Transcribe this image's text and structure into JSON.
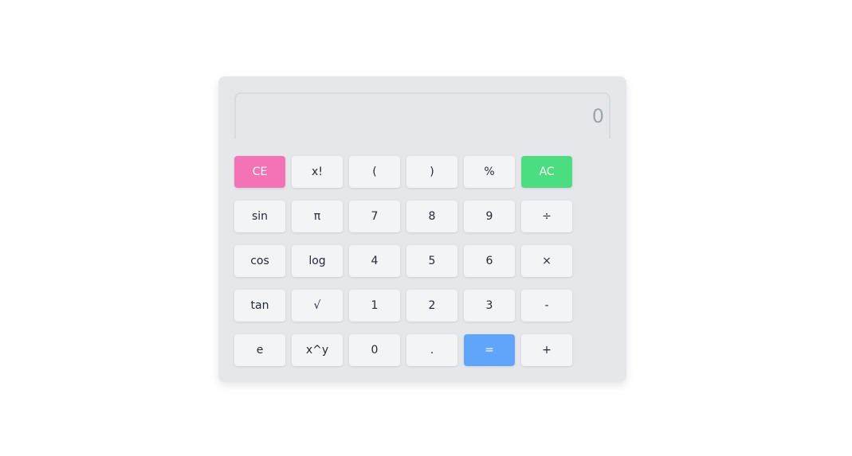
{
  "display": {
    "value": "0"
  },
  "keys": [
    {
      "label": "CE",
      "name": "clear-entry-button",
      "style": "pink"
    },
    {
      "label": "x!",
      "name": "factorial-button",
      "style": ""
    },
    {
      "label": "(",
      "name": "open-paren-button",
      "style": ""
    },
    {
      "label": ")",
      "name": "close-paren-button",
      "style": ""
    },
    {
      "label": "%",
      "name": "percent-button",
      "style": ""
    },
    {
      "label": "AC",
      "name": "all-clear-button",
      "style": "green"
    },
    {
      "label": "sin",
      "name": "sin-button",
      "style": ""
    },
    {
      "label": "π",
      "name": "pi-button",
      "style": ""
    },
    {
      "label": "7",
      "name": "digit-7-button",
      "style": ""
    },
    {
      "label": "8",
      "name": "digit-8-button",
      "style": ""
    },
    {
      "label": "9",
      "name": "digit-9-button",
      "style": ""
    },
    {
      "label": "÷",
      "name": "divide-button",
      "style": ""
    },
    {
      "label": "cos",
      "name": "cos-button",
      "style": ""
    },
    {
      "label": "log",
      "name": "log-button",
      "style": ""
    },
    {
      "label": "4",
      "name": "digit-4-button",
      "style": ""
    },
    {
      "label": "5",
      "name": "digit-5-button",
      "style": ""
    },
    {
      "label": "6",
      "name": "digit-6-button",
      "style": ""
    },
    {
      "label": "×",
      "name": "multiply-button",
      "style": ""
    },
    {
      "label": "tan",
      "name": "tan-button",
      "style": ""
    },
    {
      "label": "√",
      "name": "sqrt-button",
      "style": ""
    },
    {
      "label": "1",
      "name": "digit-1-button",
      "style": ""
    },
    {
      "label": "2",
      "name": "digit-2-button",
      "style": ""
    },
    {
      "label": "3",
      "name": "digit-3-button",
      "style": ""
    },
    {
      "label": "-",
      "name": "subtract-button",
      "style": ""
    },
    {
      "label": "e",
      "name": "euler-button",
      "style": ""
    },
    {
      "label": "x^y",
      "name": "power-button",
      "style": ""
    },
    {
      "label": "0",
      "name": "digit-0-button",
      "style": ""
    },
    {
      "label": ".",
      "name": "decimal-button",
      "style": ""
    },
    {
      "label": "=",
      "name": "equals-button",
      "style": "blue"
    },
    {
      "label": "+",
      "name": "add-button",
      "style": ""
    }
  ]
}
